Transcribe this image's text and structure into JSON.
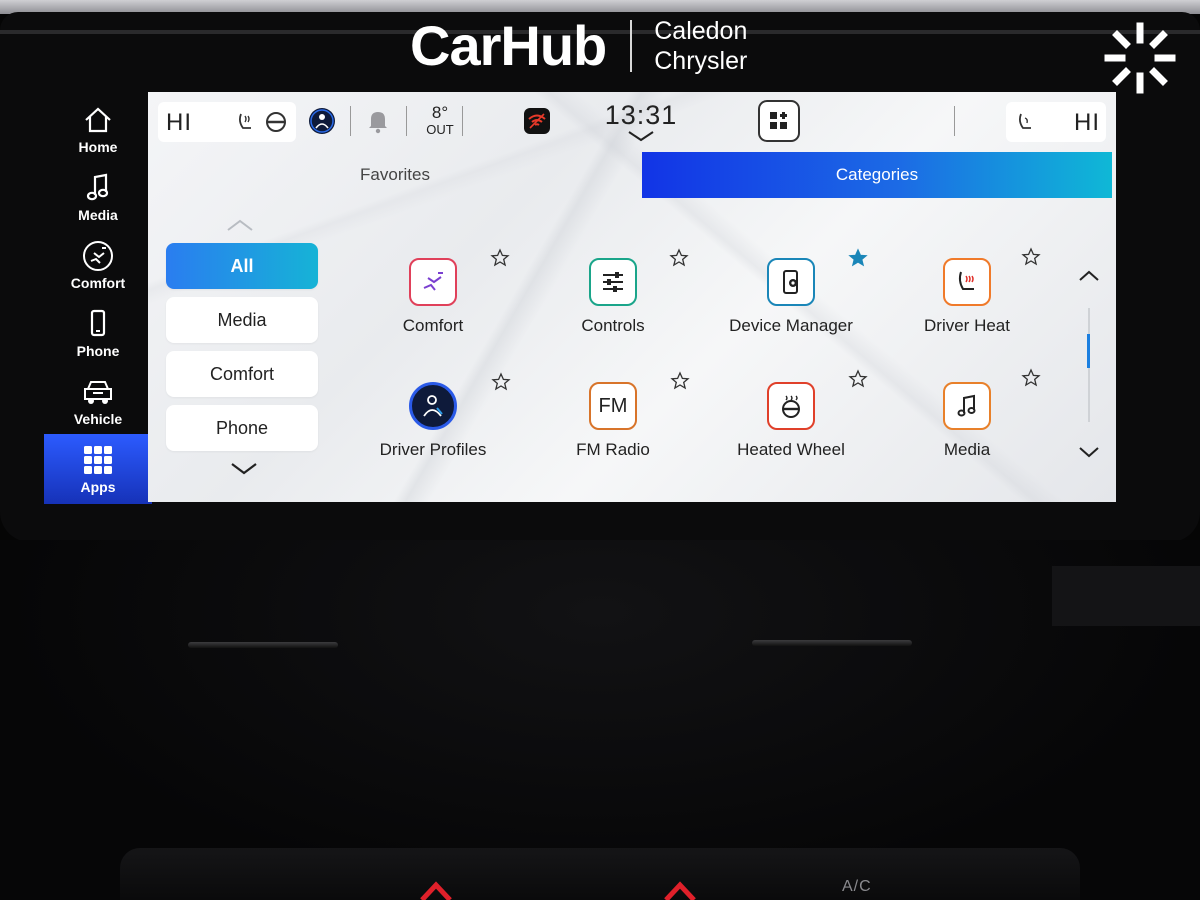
{
  "watermark": {
    "logo": "CarHub",
    "dealer_line1": "Caledon",
    "dealer_line2": "Chrysler"
  },
  "rail": {
    "items": [
      {
        "label": "Home",
        "icon": "home-icon"
      },
      {
        "label": "Media",
        "icon": "music-note-icon"
      },
      {
        "label": "Comfort",
        "icon": "comfort-icon"
      },
      {
        "label": "Phone",
        "icon": "phone-icon"
      },
      {
        "label": "Vehicle",
        "icon": "vehicle-icon"
      },
      {
        "label": "Apps",
        "icon": "apps-grid-icon",
        "active": true
      }
    ]
  },
  "status": {
    "driver_fan": "HI",
    "temperature_value": "8°",
    "temperature_unit": "OUT",
    "clock": "13:31",
    "passenger_fan": "HI"
  },
  "tabs": {
    "favorites": "Favorites",
    "categories": "Categories",
    "active": "Categories"
  },
  "categories": {
    "items": [
      {
        "label": "All",
        "active": true
      },
      {
        "label": "Media"
      },
      {
        "label": "Comfort"
      },
      {
        "label": "Phone"
      }
    ]
  },
  "apps": {
    "items": [
      {
        "label": "Comfort",
        "icon": "comfort-seat-icon",
        "favorite": false
      },
      {
        "label": "Controls",
        "icon": "sliders-icon",
        "favorite": false
      },
      {
        "label": "Device Manager",
        "icon": "device-manager-icon",
        "favorite": true
      },
      {
        "label": "Driver Heat",
        "icon": "heated-seat-icon",
        "favorite": false
      },
      {
        "label": "Driver Profiles",
        "icon": "driver-profile-icon",
        "favorite": false
      },
      {
        "label": "FM Radio",
        "icon": "fm-radio-icon",
        "icon_text": "FM",
        "favorite": false
      },
      {
        "label": "Heated Wheel",
        "icon": "heated-wheel-icon",
        "favorite": false
      },
      {
        "label": "Media",
        "icon": "music-note-icon",
        "favorite": false
      }
    ]
  },
  "hvac": {
    "ac_label": "A/C"
  },
  "colors": {
    "accent_blue": "#1c6be5",
    "accent_cyan": "#0fb8d6",
    "favorite_star": "#1a86b8",
    "rail_active": "#2c5bff",
    "hvac_red": "#e0202a"
  }
}
